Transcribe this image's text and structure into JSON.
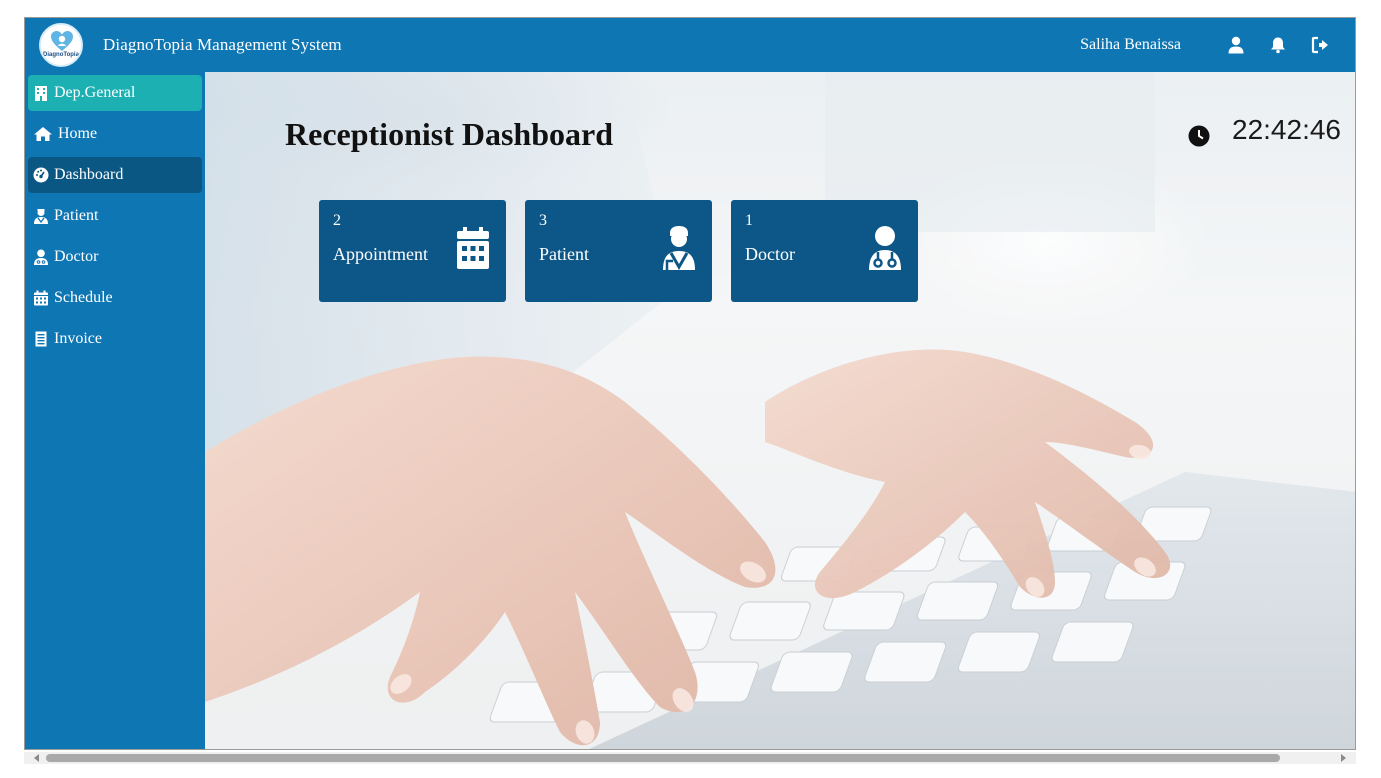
{
  "header": {
    "logo_text": "DiagnoTopia",
    "app_title": "DiagnoTopia Management System",
    "user_name": "Saliha Benaissa",
    "icons": [
      "user-icon",
      "bell-icon",
      "logout-icon"
    ]
  },
  "sidebar": {
    "items": [
      {
        "label": "Dep.General",
        "icon": "building-icon",
        "state": "department"
      },
      {
        "label": "Home",
        "icon": "home-icon",
        "state": "normal"
      },
      {
        "label": "Dashboard",
        "icon": "dashboard-icon",
        "state": "active"
      },
      {
        "label": "Patient",
        "icon": "patient-icon",
        "state": "normal"
      },
      {
        "label": "Doctor",
        "icon": "doctor-icon",
        "state": "normal"
      },
      {
        "label": "Schedule",
        "icon": "calendar-icon",
        "state": "normal"
      },
      {
        "label": "Invoice",
        "icon": "invoice-icon",
        "state": "normal"
      }
    ]
  },
  "main": {
    "title": "Receptionist Dashboard",
    "clock": "22:42:46",
    "cards": [
      {
        "count": "2",
        "label": "Appointment",
        "icon": "calendar-icon"
      },
      {
        "count": "3",
        "label": "Patient",
        "icon": "patient-icon"
      },
      {
        "count": "1",
        "label": "Doctor",
        "icon": "doctor-icon"
      }
    ]
  },
  "colors": {
    "header": "#0f76b4",
    "sidebar": "#0f76b4",
    "department_item": "#1cb0b3",
    "active_item": "#0b5784",
    "card": "#0c5787"
  }
}
